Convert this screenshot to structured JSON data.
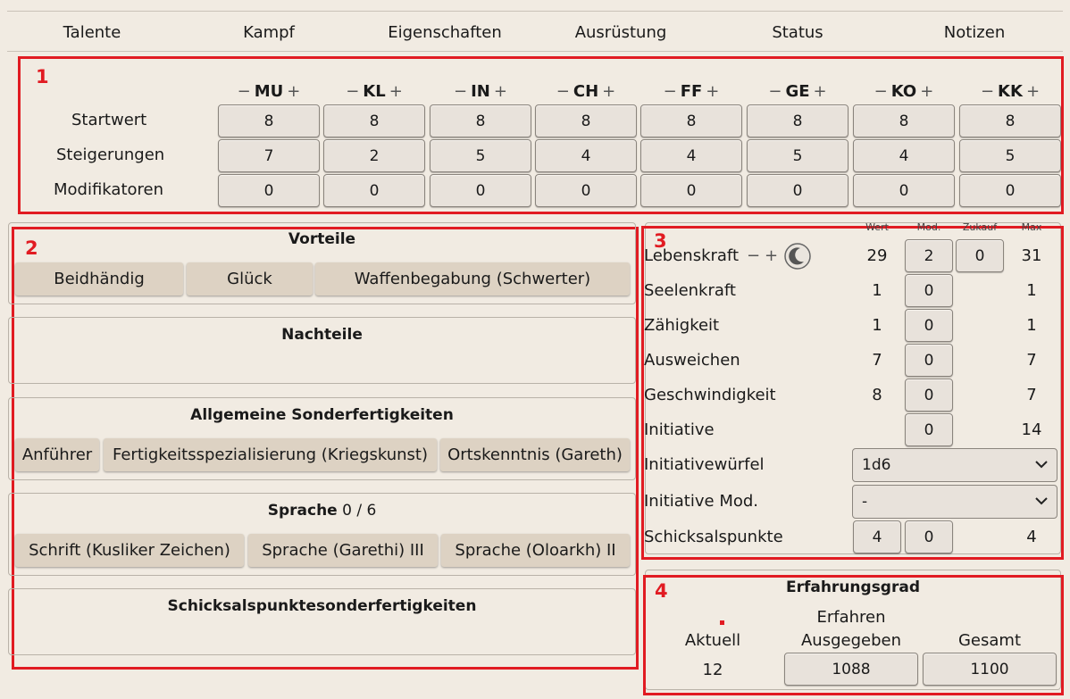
{
  "tabs": [
    "Talente",
    "Kampf",
    "Eigenschaften",
    "Ausrüstung",
    "Status",
    "Notizen"
  ],
  "markers": {
    "m1": "1",
    "m2": "2",
    "m3": "3",
    "m4": "4"
  },
  "attributes": {
    "minus": "−",
    "plus": "+",
    "names": [
      "MU",
      "KL",
      "IN",
      "CH",
      "FF",
      "GE",
      "KO",
      "KK"
    ],
    "row_labels": {
      "start": "Startwert",
      "steig": "Steigerungen",
      "mod": "Modifikatoren"
    },
    "startwert": [
      "8",
      "8",
      "8",
      "8",
      "8",
      "8",
      "8",
      "8"
    ],
    "steigerungen": [
      "7",
      "2",
      "5",
      "4",
      "4",
      "5",
      "4",
      "5"
    ],
    "modifikatoren": [
      "0",
      "0",
      "0",
      "0",
      "0",
      "0",
      "0",
      "0"
    ]
  },
  "vorteile": {
    "title": "Vorteile",
    "items": [
      "Beidhändig",
      "Glück",
      "Waffenbegabung (Schwerter)"
    ]
  },
  "nachteile": {
    "title": "Nachteile"
  },
  "sonder": {
    "title": "Allgemeine Sonderfertigkeiten",
    "items": [
      "Anführer",
      "Fertigkeitsspezialisierung (Kriegskunst)",
      "Ortskenntnis (Gareth)"
    ]
  },
  "sprache": {
    "title": "Sprache",
    "count": "0 / 6",
    "items": [
      "Schrift (Kusliker Zeichen)",
      "Sprache (Garethi) III",
      "Sprache (Oloarkh) II"
    ]
  },
  "schicksal_sf": {
    "title": "Schicksalspunktesonderfertigkeiten"
  },
  "derived": {
    "headers": {
      "wert": "Wert",
      "mod": "Mod.",
      "zukauf": "Zukauf",
      "max": "Max"
    },
    "minus": "−",
    "plus": "+",
    "rows": [
      {
        "label": "Lebenskraft",
        "wert": "29",
        "mod": "2",
        "zukauf": "0",
        "max": "31"
      },
      {
        "label": "Seelenkraft",
        "wert": "1",
        "mod": "0",
        "max": "1"
      },
      {
        "label": "Zähigkeit",
        "wert": "1",
        "mod": "0",
        "max": "1"
      },
      {
        "label": "Ausweichen",
        "wert": "7",
        "mod": "0",
        "max": "7"
      },
      {
        "label": "Geschwindigkeit",
        "wert": "8",
        "mod": "0",
        "max": "7"
      },
      {
        "label": "Initiative",
        "mod": "0",
        "max": "14"
      }
    ],
    "initiativewuerfel": {
      "label": "Initiativewürfel",
      "value": "1d6"
    },
    "initiative_mod": {
      "label": "Initiative Mod.",
      "value": "-"
    },
    "schicksalspunkte": {
      "label": "Schicksalspunkte",
      "wert": "4",
      "mod": "0",
      "max": "4"
    }
  },
  "erfahrung": {
    "title": "Erfahrungsgrad",
    "level": "Erfahren",
    "aktuell_label": "Aktuell",
    "ausgegeben_label": "Ausgegeben",
    "gesamt_label": "Gesamt",
    "aktuell": "12",
    "ausgegeben": "1088",
    "gesamt": "1100"
  },
  "colors": {
    "annotation": "#e11b22",
    "background": "#f1ebe2",
    "button": "#e8e2db",
    "tag": "#ddd2c3"
  },
  "icons": {
    "rest": "moon-icon",
    "dropdown": "chevron-down-icon"
  }
}
